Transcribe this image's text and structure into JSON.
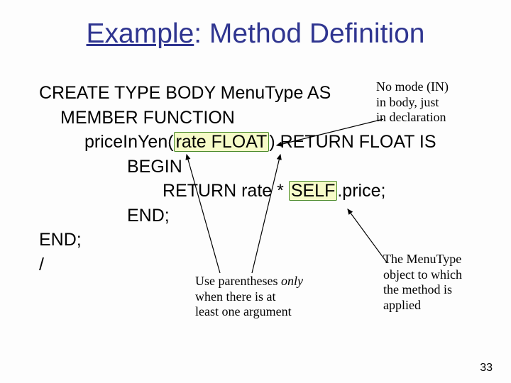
{
  "title": {
    "underlined": "Example",
    "rest": ": Method Definition"
  },
  "code": {
    "l1": "CREATE TYPE BODY MenuType AS",
    "l2": "MEMBER FUNCTION",
    "l3a": "priceInYen(",
    "l3box": "rate FLOAT",
    "l3b": ") RETURN FLOAT IS",
    "l4": "BEGIN",
    "l5a": "RETURN rate * ",
    "l5self": "SELF",
    "l5b": ".price;",
    "l6": "END;",
    "l7": "END;",
    "l8": "/"
  },
  "note_top": {
    "l1": "No mode (IN)",
    "l2": "in body, just",
    "l3": "in declaration"
  },
  "note_mid": {
    "l1": "Use parentheses ",
    "l1i": "only",
    "l2": "when there is at",
    "l3": "least one argument"
  },
  "note_right": {
    "l1": "The MenuType",
    "l2": "object to which",
    "l3": "the method is",
    "l4": "applied"
  },
  "page": "33"
}
